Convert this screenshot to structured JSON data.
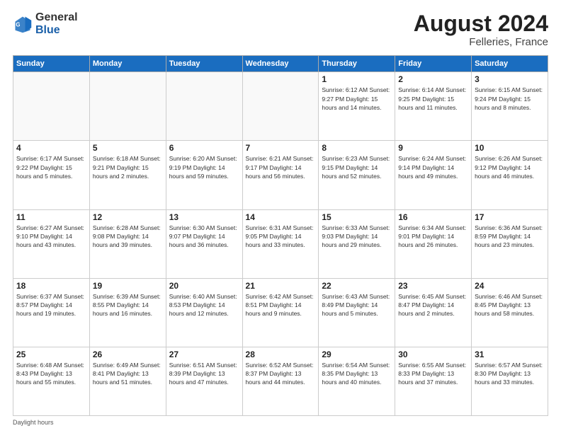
{
  "header": {
    "logo_general": "General",
    "logo_blue": "Blue",
    "title": "August 2024",
    "location": "Felleries, France"
  },
  "days_of_week": [
    "Sunday",
    "Monday",
    "Tuesday",
    "Wednesday",
    "Thursday",
    "Friday",
    "Saturday"
  ],
  "weeks": [
    [
      {
        "day": "",
        "info": ""
      },
      {
        "day": "",
        "info": ""
      },
      {
        "day": "",
        "info": ""
      },
      {
        "day": "",
        "info": ""
      },
      {
        "day": "1",
        "info": "Sunrise: 6:12 AM\nSunset: 9:27 PM\nDaylight: 15 hours\nand 14 minutes."
      },
      {
        "day": "2",
        "info": "Sunrise: 6:14 AM\nSunset: 9:25 PM\nDaylight: 15 hours\nand 11 minutes."
      },
      {
        "day": "3",
        "info": "Sunrise: 6:15 AM\nSunset: 9:24 PM\nDaylight: 15 hours\nand 8 minutes."
      }
    ],
    [
      {
        "day": "4",
        "info": "Sunrise: 6:17 AM\nSunset: 9:22 PM\nDaylight: 15 hours\nand 5 minutes."
      },
      {
        "day": "5",
        "info": "Sunrise: 6:18 AM\nSunset: 9:21 PM\nDaylight: 15 hours\nand 2 minutes."
      },
      {
        "day": "6",
        "info": "Sunrise: 6:20 AM\nSunset: 9:19 PM\nDaylight: 14 hours\nand 59 minutes."
      },
      {
        "day": "7",
        "info": "Sunrise: 6:21 AM\nSunset: 9:17 PM\nDaylight: 14 hours\nand 56 minutes."
      },
      {
        "day": "8",
        "info": "Sunrise: 6:23 AM\nSunset: 9:15 PM\nDaylight: 14 hours\nand 52 minutes."
      },
      {
        "day": "9",
        "info": "Sunrise: 6:24 AM\nSunset: 9:14 PM\nDaylight: 14 hours\nand 49 minutes."
      },
      {
        "day": "10",
        "info": "Sunrise: 6:26 AM\nSunset: 9:12 PM\nDaylight: 14 hours\nand 46 minutes."
      }
    ],
    [
      {
        "day": "11",
        "info": "Sunrise: 6:27 AM\nSunset: 9:10 PM\nDaylight: 14 hours\nand 43 minutes."
      },
      {
        "day": "12",
        "info": "Sunrise: 6:28 AM\nSunset: 9:08 PM\nDaylight: 14 hours\nand 39 minutes."
      },
      {
        "day": "13",
        "info": "Sunrise: 6:30 AM\nSunset: 9:07 PM\nDaylight: 14 hours\nand 36 minutes."
      },
      {
        "day": "14",
        "info": "Sunrise: 6:31 AM\nSunset: 9:05 PM\nDaylight: 14 hours\nand 33 minutes."
      },
      {
        "day": "15",
        "info": "Sunrise: 6:33 AM\nSunset: 9:03 PM\nDaylight: 14 hours\nand 29 minutes."
      },
      {
        "day": "16",
        "info": "Sunrise: 6:34 AM\nSunset: 9:01 PM\nDaylight: 14 hours\nand 26 minutes."
      },
      {
        "day": "17",
        "info": "Sunrise: 6:36 AM\nSunset: 8:59 PM\nDaylight: 14 hours\nand 23 minutes."
      }
    ],
    [
      {
        "day": "18",
        "info": "Sunrise: 6:37 AM\nSunset: 8:57 PM\nDaylight: 14 hours\nand 19 minutes."
      },
      {
        "day": "19",
        "info": "Sunrise: 6:39 AM\nSunset: 8:55 PM\nDaylight: 14 hours\nand 16 minutes."
      },
      {
        "day": "20",
        "info": "Sunrise: 6:40 AM\nSunset: 8:53 PM\nDaylight: 14 hours\nand 12 minutes."
      },
      {
        "day": "21",
        "info": "Sunrise: 6:42 AM\nSunset: 8:51 PM\nDaylight: 14 hours\nand 9 minutes."
      },
      {
        "day": "22",
        "info": "Sunrise: 6:43 AM\nSunset: 8:49 PM\nDaylight: 14 hours\nand 5 minutes."
      },
      {
        "day": "23",
        "info": "Sunrise: 6:45 AM\nSunset: 8:47 PM\nDaylight: 14 hours\nand 2 minutes."
      },
      {
        "day": "24",
        "info": "Sunrise: 6:46 AM\nSunset: 8:45 PM\nDaylight: 13 hours\nand 58 minutes."
      }
    ],
    [
      {
        "day": "25",
        "info": "Sunrise: 6:48 AM\nSunset: 8:43 PM\nDaylight: 13 hours\nand 55 minutes."
      },
      {
        "day": "26",
        "info": "Sunrise: 6:49 AM\nSunset: 8:41 PM\nDaylight: 13 hours\nand 51 minutes."
      },
      {
        "day": "27",
        "info": "Sunrise: 6:51 AM\nSunset: 8:39 PM\nDaylight: 13 hours\nand 47 minutes."
      },
      {
        "day": "28",
        "info": "Sunrise: 6:52 AM\nSunset: 8:37 PM\nDaylight: 13 hours\nand 44 minutes."
      },
      {
        "day": "29",
        "info": "Sunrise: 6:54 AM\nSunset: 8:35 PM\nDaylight: 13 hours\nand 40 minutes."
      },
      {
        "day": "30",
        "info": "Sunrise: 6:55 AM\nSunset: 8:33 PM\nDaylight: 13 hours\nand 37 minutes."
      },
      {
        "day": "31",
        "info": "Sunrise: 6:57 AM\nSunset: 8:30 PM\nDaylight: 13 hours\nand 33 minutes."
      }
    ]
  ],
  "footer": {
    "note": "Daylight hours"
  }
}
